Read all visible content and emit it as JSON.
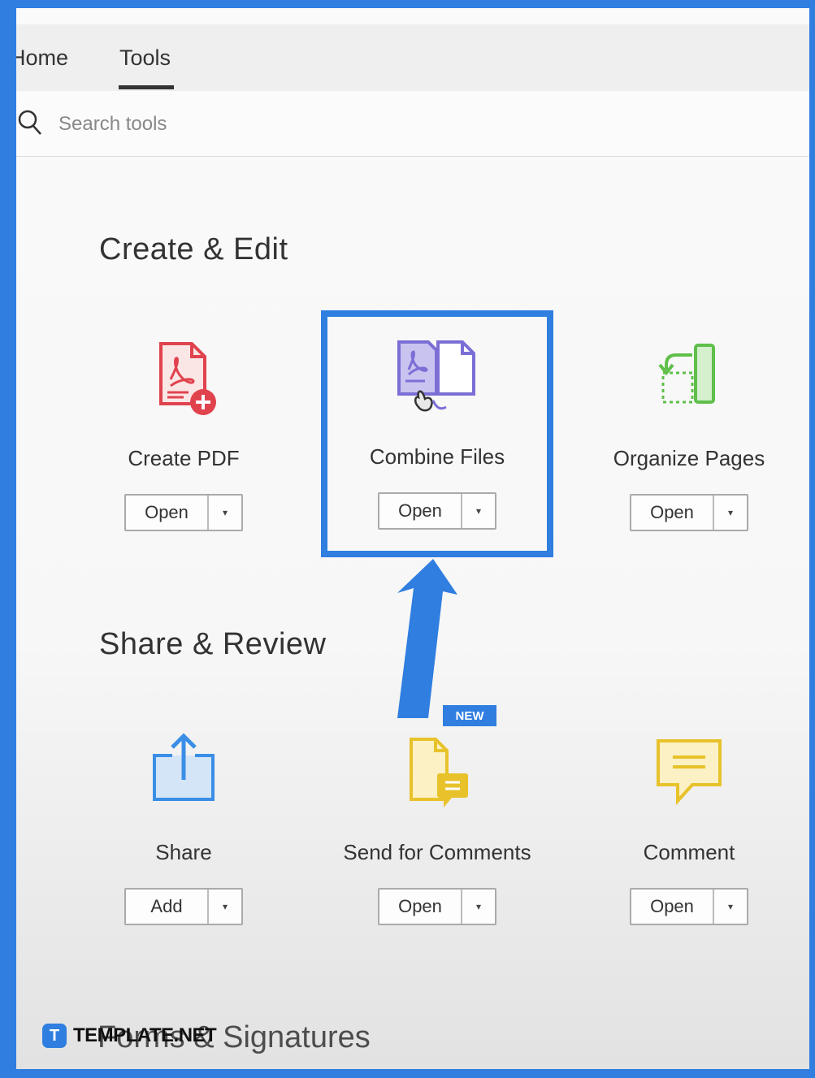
{
  "tabs": [
    {
      "label": "Home"
    },
    {
      "label": "Tools"
    }
  ],
  "search": {
    "placeholder": "Search tools"
  },
  "sections": {
    "create_edit": "Create & Edit",
    "share_review": "Share & Review",
    "forms_signatures": "Forms & Signatures"
  },
  "tools": {
    "create_pdf": {
      "name": "Create PDF",
      "button": "Open",
      "icon": "create-pdf-icon",
      "color": "#e0434e"
    },
    "combine_files": {
      "name": "Combine Files",
      "button": "Open",
      "icon": "combine-files-icon",
      "color": "#7b6fd6"
    },
    "organize_pages": {
      "name": "Organize Pages",
      "button": "Open",
      "icon": "organize-pages-icon",
      "color": "#5fbf4a"
    },
    "share": {
      "name": "Share",
      "button": "Add",
      "icon": "share-icon",
      "color": "#3a8ee6"
    },
    "send_for_comments": {
      "name": "Send for Comments",
      "button": "Open",
      "icon": "send-for-comments-icon",
      "color": "#e8c22a",
      "badge": "NEW"
    },
    "comment": {
      "name": "Comment",
      "button": "Open",
      "icon": "comment-icon",
      "color": "#e8c22a"
    }
  },
  "dropdown_glyph": "▾",
  "accent_color": "#2f7ee0",
  "watermark": {
    "logo": "T",
    "text": "TEMPLATE.NET"
  }
}
